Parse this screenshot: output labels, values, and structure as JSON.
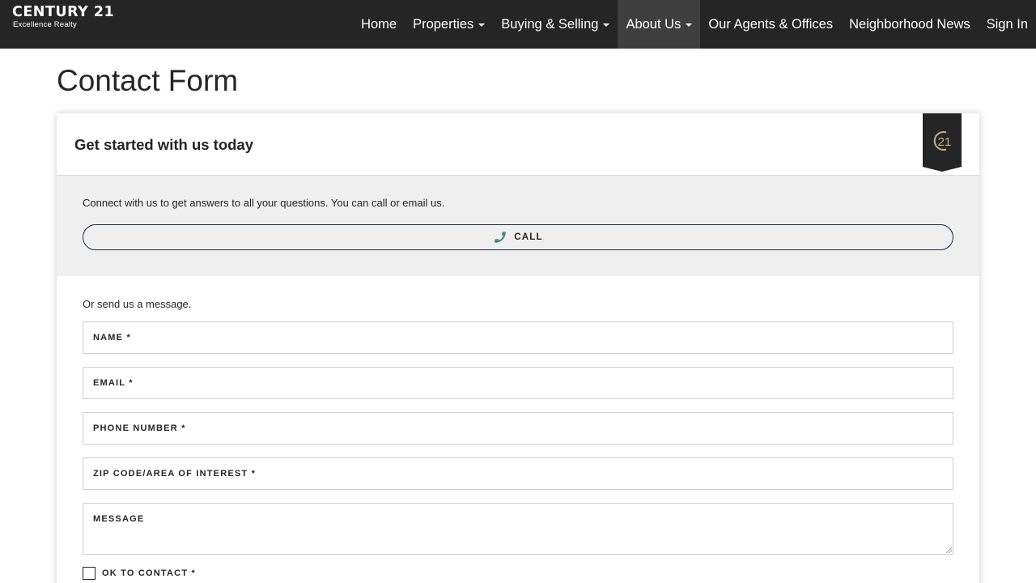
{
  "brand": {
    "name": "CENTURY 21",
    "tagline": "Excellence Realty",
    "badge_text": "21"
  },
  "nav": {
    "items": [
      {
        "label": "Home",
        "has_dropdown": false,
        "active": false
      },
      {
        "label": "Properties",
        "has_dropdown": true,
        "active": false
      },
      {
        "label": "Buying & Selling",
        "has_dropdown": true,
        "active": false
      },
      {
        "label": "About Us",
        "has_dropdown": true,
        "active": true
      },
      {
        "label": "Our Agents & Offices",
        "has_dropdown": false,
        "active": false
      },
      {
        "label": "Neighborhood News",
        "has_dropdown": false,
        "active": false
      },
      {
        "label": "Sign In",
        "has_dropdown": false,
        "active": false
      }
    ]
  },
  "page": {
    "title": "Contact Form"
  },
  "card": {
    "title": "Get started with us today",
    "call_intro": "Connect with us to get answers to all your questions. You can call or email us.",
    "call_button_label": "CALL",
    "message_intro": "Or send us a message.",
    "fields": {
      "name": {
        "label": "NAME *",
        "value": ""
      },
      "email": {
        "label": "EMAIL *",
        "value": ""
      },
      "phone": {
        "label": "PHONE NUMBER *",
        "value": ""
      },
      "zip": {
        "label": "ZIP CODE/AREA OF INTEREST *",
        "value": ""
      },
      "message": {
        "label": "MESSAGE",
        "value": ""
      }
    },
    "ok_to_contact": {
      "label": "OK TO CONTACT *",
      "checked": false
    }
  },
  "icons": {
    "call_button": "phone-icon",
    "badge": "century21-seal-icon",
    "nav_dropdown": "caret-down-icon"
  },
  "colors": {
    "topbar": "#252526",
    "nav_active": "#3e3e3e",
    "gold": "#beaf87",
    "phone_icon": "#3d8a8a",
    "button_border": "#1a2b4c",
    "section_bg": "#efefef"
  }
}
